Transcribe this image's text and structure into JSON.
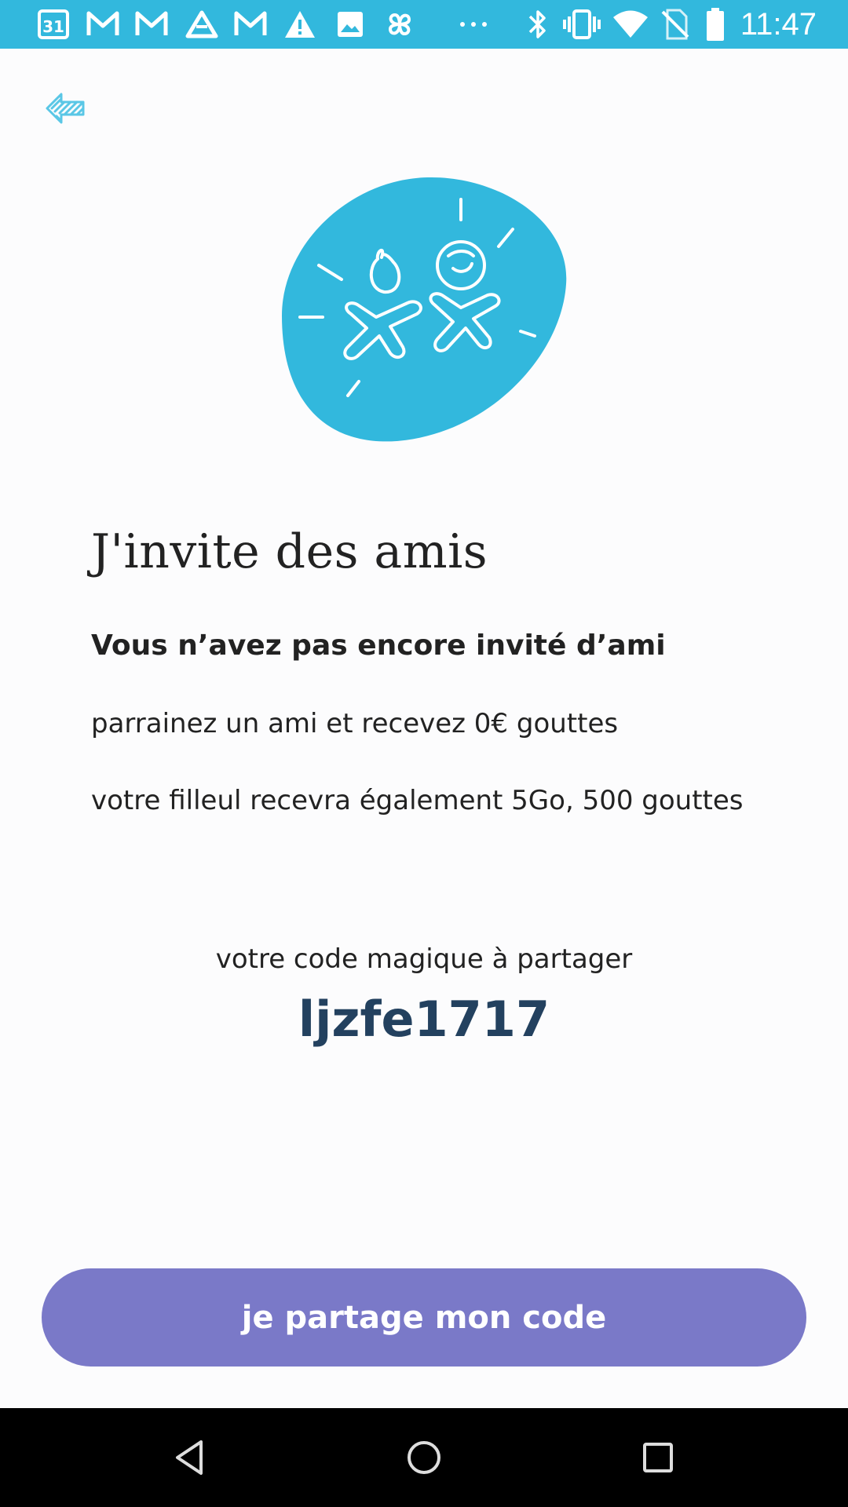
{
  "status_bar": {
    "time": "11:47",
    "calendar_day": "31",
    "colors": {
      "background": "#32b8dd"
    },
    "icons": [
      "calendar-icon",
      "gmail-icon",
      "gmail-icon",
      "drive-icon",
      "gmail-icon",
      "warning-icon",
      "image-icon",
      "pinwheel-icon",
      "more-icon",
      "bluetooth-icon",
      "vibrate-icon",
      "wifi-icon",
      "no-sim-icon",
      "battery-icon"
    ]
  },
  "header": {
    "back_icon": "back-arrow-icon"
  },
  "content": {
    "title": "J'invite des amis",
    "subtitle": "Vous n’avez pas encore invité d’ami",
    "line1": "parrainez un ami et recevez 0€ gouttes",
    "line2": "votre filleul recevra également 5Go, 500 gouttes",
    "code_label": "votre code magique à partager",
    "code": "ljzfe1717"
  },
  "actions": {
    "share_label": "je partage mon code"
  },
  "colors": {
    "accent": "#32b8dd",
    "button": "#7a79c8",
    "code_text": "#23415f"
  },
  "nav_bar": {
    "icons": [
      "back-triangle-icon",
      "home-circle-icon",
      "recents-square-icon"
    ]
  }
}
